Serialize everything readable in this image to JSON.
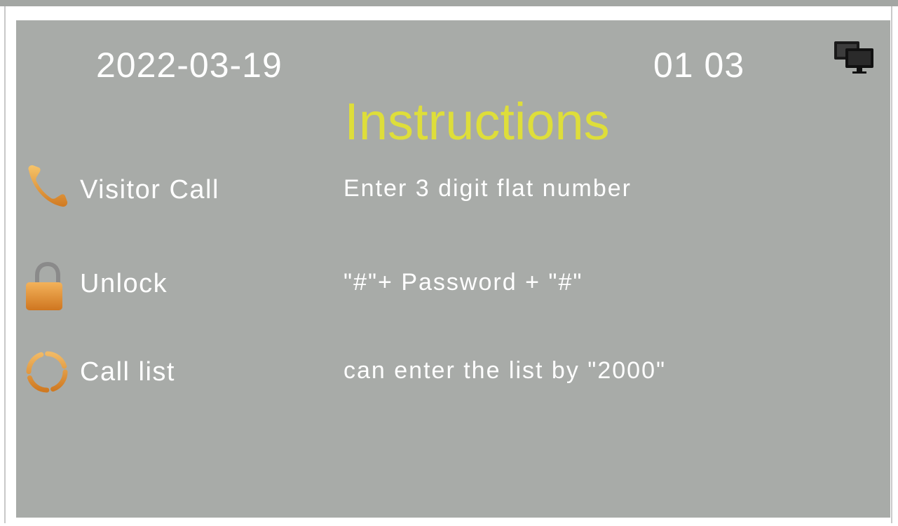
{
  "header": {
    "date": "2022-03-19",
    "time": "01 03",
    "status_icon": "monitors-icon"
  },
  "title": "Instructions",
  "instructions": [
    {
      "icon": "phone-icon",
      "label": "Visitor Call",
      "description": "Enter 3 digit flat number"
    },
    {
      "icon": "lock-icon",
      "label": "Unlock",
      "description": "\"#\"+ Password + \"#\""
    },
    {
      "icon": "call-list-icon",
      "label": "Call list",
      "description": "can enter the list by \"2000\""
    }
  ],
  "colors": {
    "screen_background": "#a8aba8",
    "title": "#dede3a",
    "text": "#ffffff",
    "icon_accent": "#e49a36"
  }
}
